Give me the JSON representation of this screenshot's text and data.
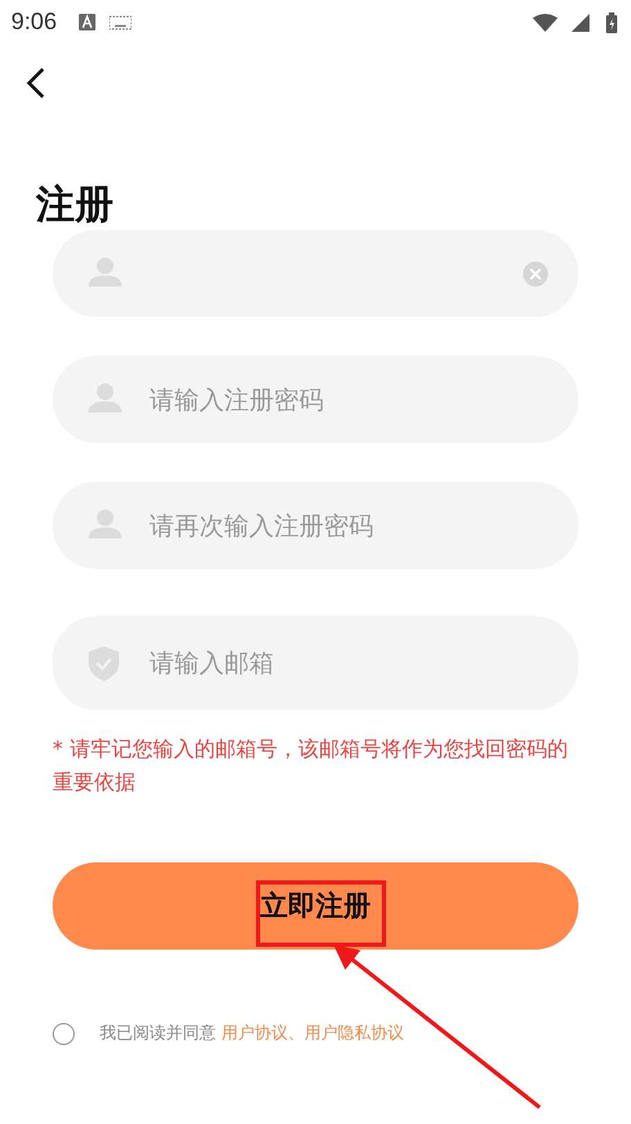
{
  "status_bar": {
    "time": "9:06"
  },
  "title": "注册",
  "fields": [
    {
      "kind": "person",
      "clear_button": true
    },
    {
      "kind": "person",
      "placeholder": "请输入注册密码",
      "clear_button": false
    },
    {
      "kind": "person",
      "placeholder": "请再次输入注册密码",
      "clear_button": false
    },
    {
      "kind": "shield",
      "placeholder": "请输入邮箱",
      "clear_button": false
    }
  ],
  "note": "* 请牢记您输入的邮箱号，该邮箱号将作为您找回密码的重要依据",
  "submit_button": {
    "label": "立即注册",
    "highlighted": true
  },
  "agreement": {
    "checked": false,
    "text": "我已阅读并同意",
    "links": [
      "用户协议",
      "用户隐私协议"
    ],
    "separator": "、"
  },
  "annotation_arrow": true
}
